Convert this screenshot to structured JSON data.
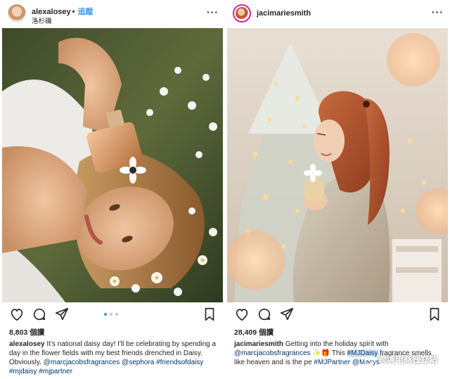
{
  "left_post": {
    "username": "alexalosey",
    "follow_sep": "•",
    "follow_label": "追蹤",
    "location": "洛杉磯",
    "more_label": "···",
    "likes": "8,803 個讚",
    "caption": {
      "username": "alexalosey",
      "text": "It's national daisy day! I'll be celebrating by spending a day in the flower fields with my best friends drenched in Daisy. Obviously.",
      "tags": [
        "@marcjacobsfragrances",
        "@sephora",
        "#friendsofdaisy",
        "#mjdaisy",
        "#mjpartner"
      ]
    },
    "carousel": {
      "count": 3,
      "active": 0
    }
  },
  "right_post": {
    "username": "jacimariesmith",
    "more_label": "···",
    "likes": "28,409 個讚",
    "caption": {
      "username": "jacimariesmith",
      "text1": "Getting into the holiday spirit with",
      "mention": "@marcjacobsfragrances",
      "emoji": "✨🎁",
      "text2": "This",
      "highlight": "#MJDaisy",
      "text3": "fragrance smells like heaven and is the pe",
      "tags": [
        "#MJPartner",
        "@Macys"
      ]
    }
  },
  "watermark": "跨境电商独立站",
  "colors": {
    "link": "#003569",
    "follow": "#3897f0",
    "story_ring": "#d6249f"
  }
}
